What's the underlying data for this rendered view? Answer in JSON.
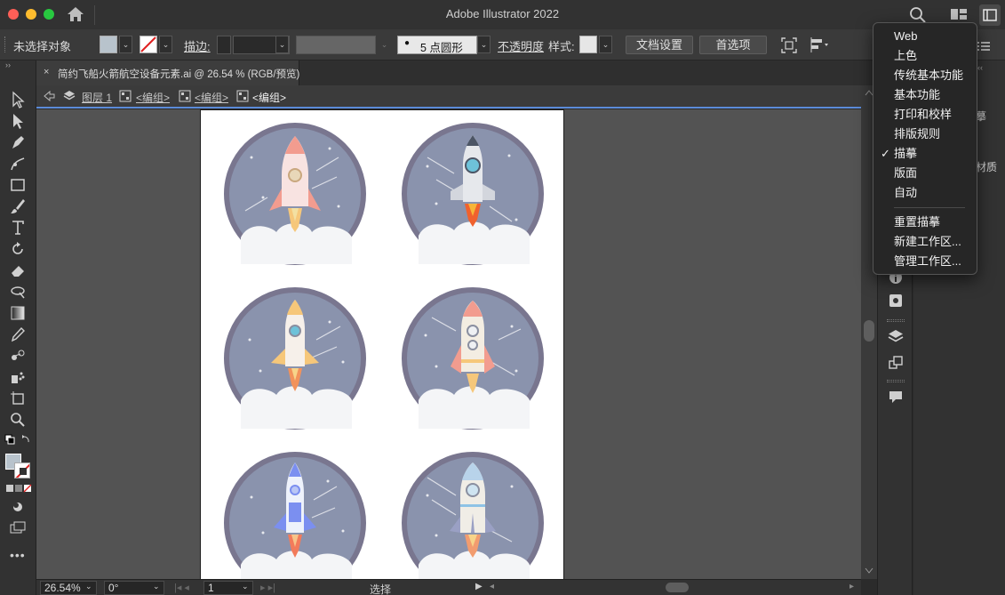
{
  "window": {
    "title": "Adobe Illustrator 2022"
  },
  "control_bar": {
    "selection_status": "未选择对象",
    "stroke_label": "描边:",
    "brush_label": "5 点圆形",
    "opacity_label": "不透明度",
    "style_label": "样式:",
    "doc_settings_button": "文档设置",
    "preferences_button": "首选项"
  },
  "document_tab": {
    "close_glyph": "×",
    "title": "简约飞船火箭航空设备元素.ai @ 26.54 % (RGB/预览)"
  },
  "breadcrumb": {
    "layer": "图层 1",
    "group1": "<编组>",
    "group2": "<编组>",
    "current": "<编组>"
  },
  "status_bar": {
    "zoom": "26.54%",
    "rotation": "0°",
    "artboard_number": "1",
    "tool_status": "选择"
  },
  "right_panel": {
    "tab_label_fragment_1": "摹",
    "tab_label_fragment_2": "材质"
  },
  "workspace_menu": {
    "items": [
      {
        "label": "Web",
        "checked": false
      },
      {
        "label": "上色",
        "checked": false
      },
      {
        "label": "传统基本功能",
        "checked": false
      },
      {
        "label": "基本功能",
        "checked": false
      },
      {
        "label": "打印和校样",
        "checked": false
      },
      {
        "label": "排版规则",
        "checked": false
      },
      {
        "label": "描摹",
        "checked": true
      },
      {
        "label": "版面",
        "checked": false
      },
      {
        "label": "自动",
        "checked": false
      }
    ],
    "actions": [
      {
        "label": "重置描摹"
      },
      {
        "label": "新建工作区..."
      },
      {
        "label": "管理工作区..."
      }
    ],
    "check_glyph": "✓"
  },
  "colors": {
    "badge_ring": "#79768f",
    "badge_sky": "#8a93ad",
    "accent_blue": "#5b8bd9"
  }
}
